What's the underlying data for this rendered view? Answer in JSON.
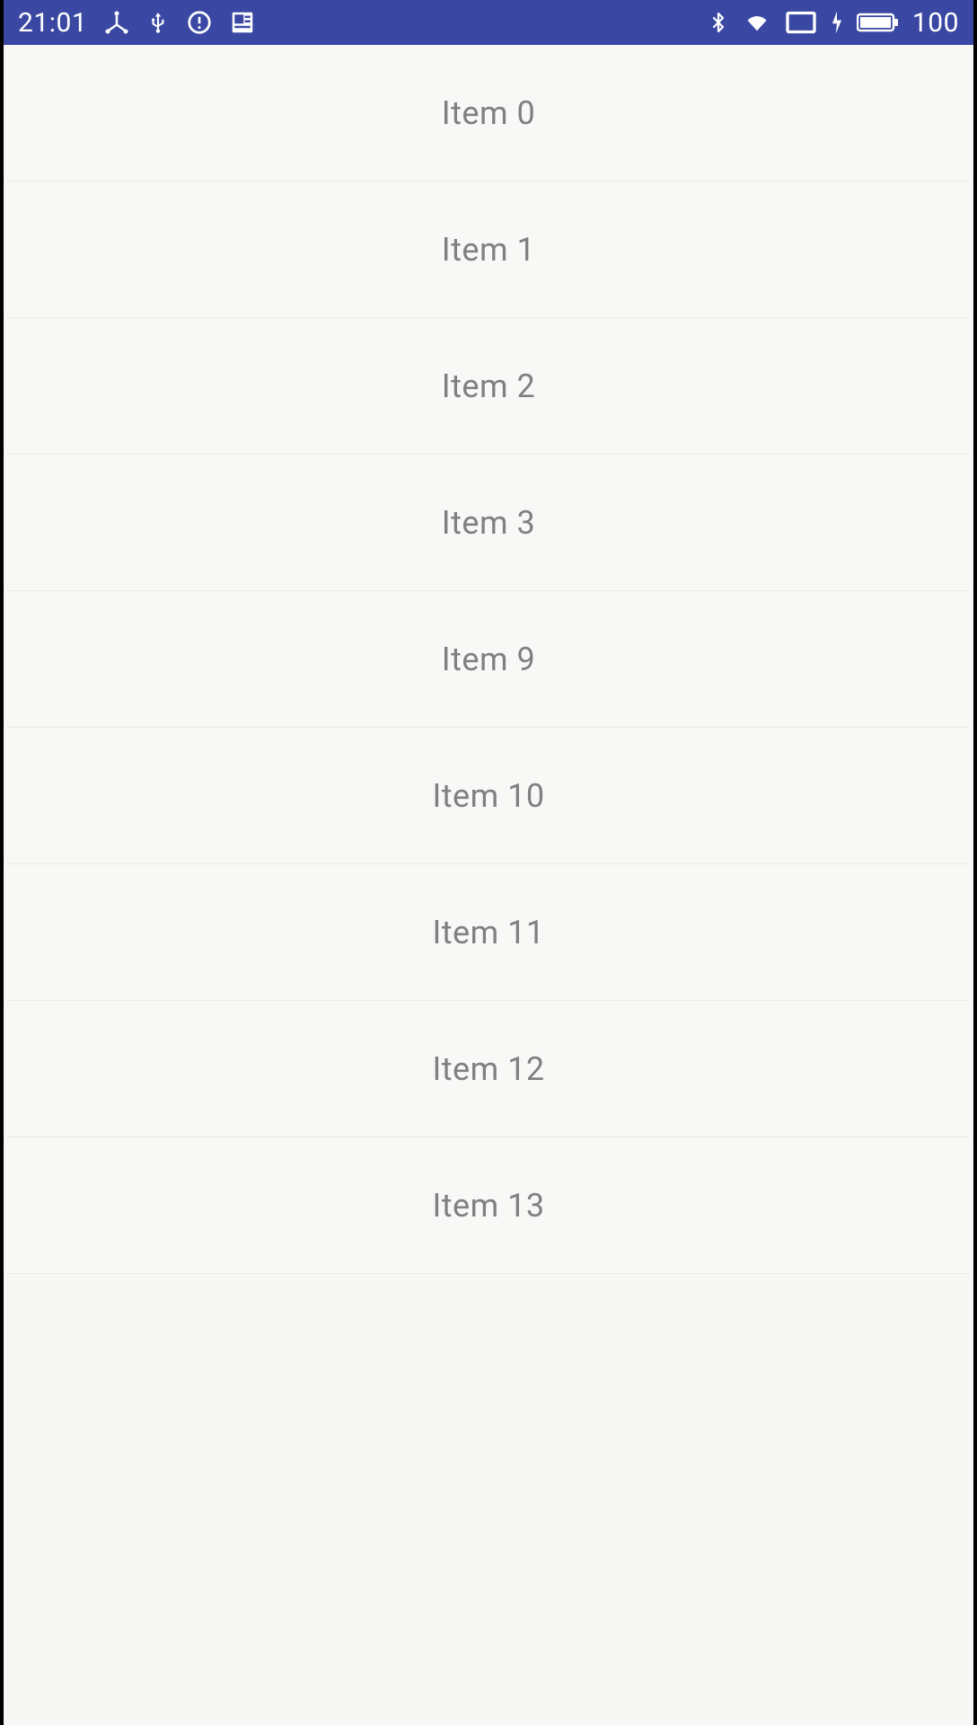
{
  "status_bar": {
    "time": "21:01",
    "battery_percent": "100"
  },
  "list": {
    "items": [
      {
        "label": "Item 0"
      },
      {
        "label": "Item 1"
      },
      {
        "label": "Item 2"
      },
      {
        "label": "Item 3"
      },
      {
        "label": "Item 9"
      },
      {
        "label": "Item 10"
      },
      {
        "label": "Item 11"
      },
      {
        "label": "Item 12"
      },
      {
        "label": "Item 13"
      }
    ]
  }
}
